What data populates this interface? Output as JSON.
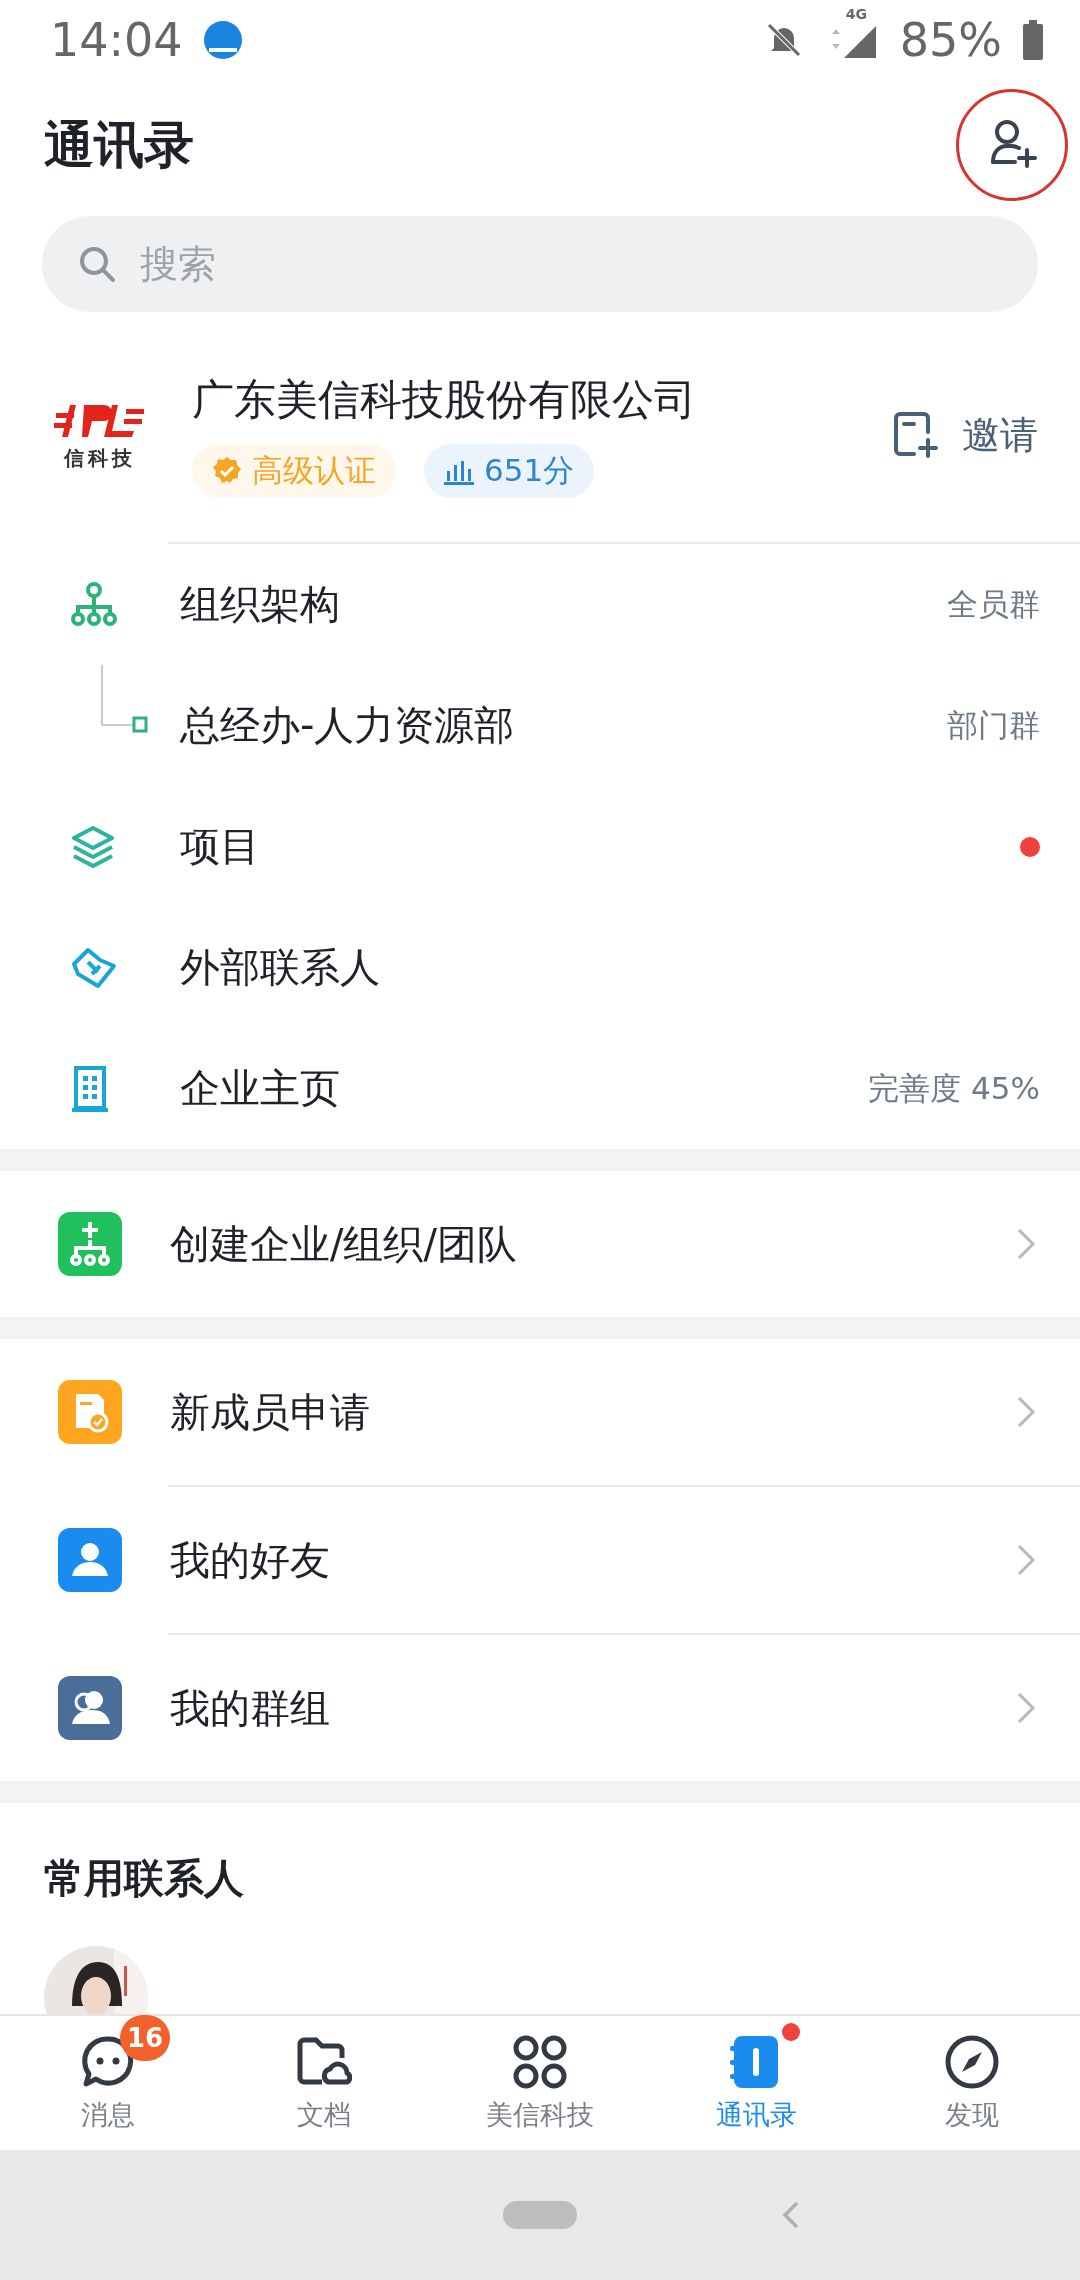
{
  "status_bar": {
    "time": "14:04",
    "network": "4G",
    "battery": "85%"
  },
  "header": {
    "title": "通讯录"
  },
  "search": {
    "placeholder": "搜索"
  },
  "company": {
    "name": "广东美信科技股份有限公司",
    "logo_text": "信科技",
    "badges": [
      {
        "kind": "certified",
        "label": "高级认证"
      },
      {
        "kind": "score",
        "label": "651分"
      }
    ],
    "invite": "邀请"
  },
  "org_items": [
    {
      "kind": "org",
      "label": "组织架构",
      "note": "全员群",
      "children": [
        {
          "kind": "dept",
          "label": "总经办-人力资源部",
          "note": "部门群"
        }
      ]
    },
    {
      "kind": "project",
      "label": "项目",
      "unread": true
    },
    {
      "kind": "external",
      "label": "外部联系人",
      "unread": false
    },
    {
      "kind": "homepage",
      "label": "企业主页",
      "note": "完善度 45%"
    }
  ],
  "create": {
    "label": "创建企业/组织/团队"
  },
  "menu": [
    {
      "kind": "apply",
      "label": "新成员申请"
    },
    {
      "kind": "friends",
      "label": "我的好友"
    },
    {
      "kind": "groups",
      "label": "我的群组"
    }
  ],
  "frequent": {
    "title": "常用联系人"
  },
  "tabs": [
    {
      "kind": "chat",
      "label": "消息",
      "badge": "16",
      "selected": false,
      "unread": false
    },
    {
      "kind": "docs",
      "label": "文档",
      "selected": false,
      "unread": false
    },
    {
      "kind": "apps",
      "label": "美信科技",
      "selected": false,
      "unread": false
    },
    {
      "kind": "contacts",
      "label": "通讯录",
      "selected": true,
      "unread": true
    },
    {
      "kind": "discover",
      "label": "发现",
      "selected": false,
      "unread": false
    }
  ]
}
